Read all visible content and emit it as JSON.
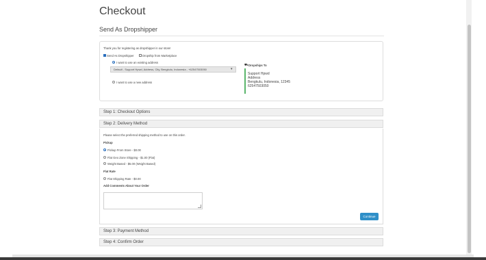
{
  "page": {
    "title": "Checkout",
    "subtitle": "Send As Dropshipper"
  },
  "dropshipper": {
    "thanks": "Thank you for registering as dropshipper in our store!",
    "send_as_label": "Send As Dropshipper",
    "marketplace_label": "Dropship from Marketplace",
    "existing_label": "I want to use an existing address",
    "existing_value": "Default - Support Hpwd, Address, City, Bengkulu, Indonesia - +62547503050",
    "new_label": "I want to use a new address",
    "ships_to_heading": "Dropships To",
    "ships_to_lines": [
      "Support Hpwd",
      "Address",
      "Bengkulu, Indonesia, 12345",
      "62547503050"
    ]
  },
  "steps": {
    "step1": "Step 1: Checkout Options",
    "step2": "Step 2: Delivery Method",
    "step3": "Step 3: Payment Method",
    "step4": "Step 4: Confirm Order"
  },
  "delivery": {
    "intro": "Please select the preferred shipping method to use on this order.",
    "pickup_heading": "Pickup",
    "options": [
      "Pickup From Store - $0.00",
      "Flat Geo Zone Shipping - $1.00 (Flat)",
      "Weight Based - $5.00 (Weight Based)"
    ],
    "flat_heading": "Flat Rate",
    "flat_option": "Flat Shipping Rate - $0.00",
    "comments_heading": "Add Comments About Your Order",
    "continue_label": "Continue"
  }
}
